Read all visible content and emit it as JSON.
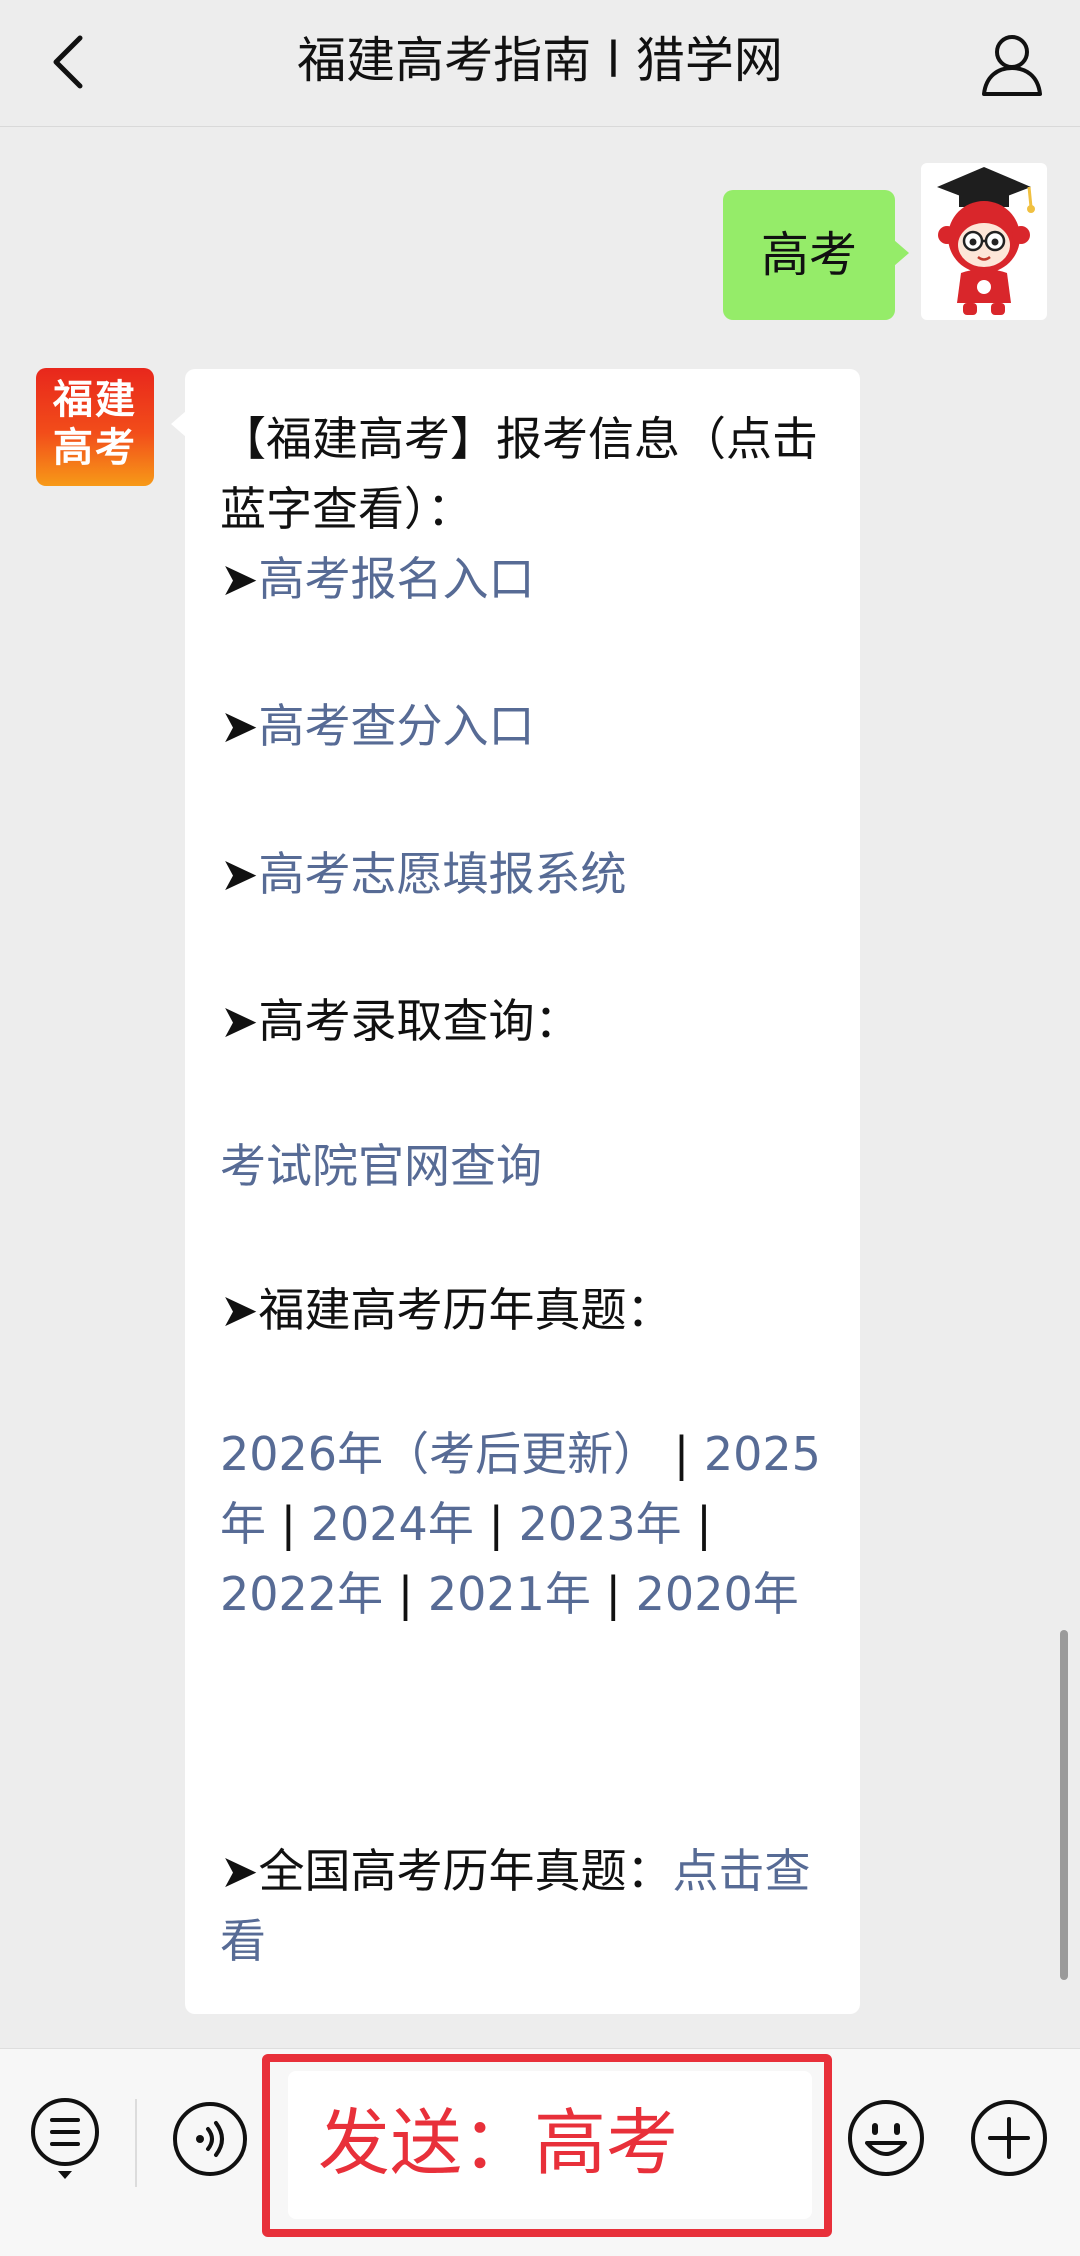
{
  "header": {
    "title": "福建高考指南 l 猎学网",
    "back_icon": "chevron-left-icon",
    "profile_icon": "person-icon"
  },
  "chat": {
    "my_message": "高考",
    "account_avatar_line1": "福建",
    "account_avatar_line2": "高考",
    "reply": {
      "intro": "【福建高考】报考信息（点击蓝字查看）：",
      "arrow": "➤",
      "link_register": "高考报名入口",
      "link_score": "高考查分入口",
      "link_volunteer": "高考志愿填报系统",
      "admission_label": "高考录取查询：",
      "link_exam_site": "考试院官网查询",
      "past_papers_label": "福建高考历年真题：",
      "year_2026": "2026年（考后更新）",
      "separator": "|",
      "year_2025": "2025年",
      "year_2024": "2024年",
      "year_2023": "2023年",
      "year_2022": "2022年",
      "year_2021": "2021年",
      "year_2020": "2020年",
      "national_label": "全国高考历年真题：",
      "link_click_view": "点击查看"
    }
  },
  "input_bar": {
    "input_text": "发送：高考",
    "menu_icon": "menu-list-icon",
    "voice_icon": "voice-icon",
    "emoji_icon": "emoji-icon",
    "plus_icon": "plus-circle-icon"
  },
  "colors": {
    "background": "#ededed",
    "my_bubble": "#95ec69",
    "link": "#576b95",
    "highlight": "#e8303a"
  }
}
